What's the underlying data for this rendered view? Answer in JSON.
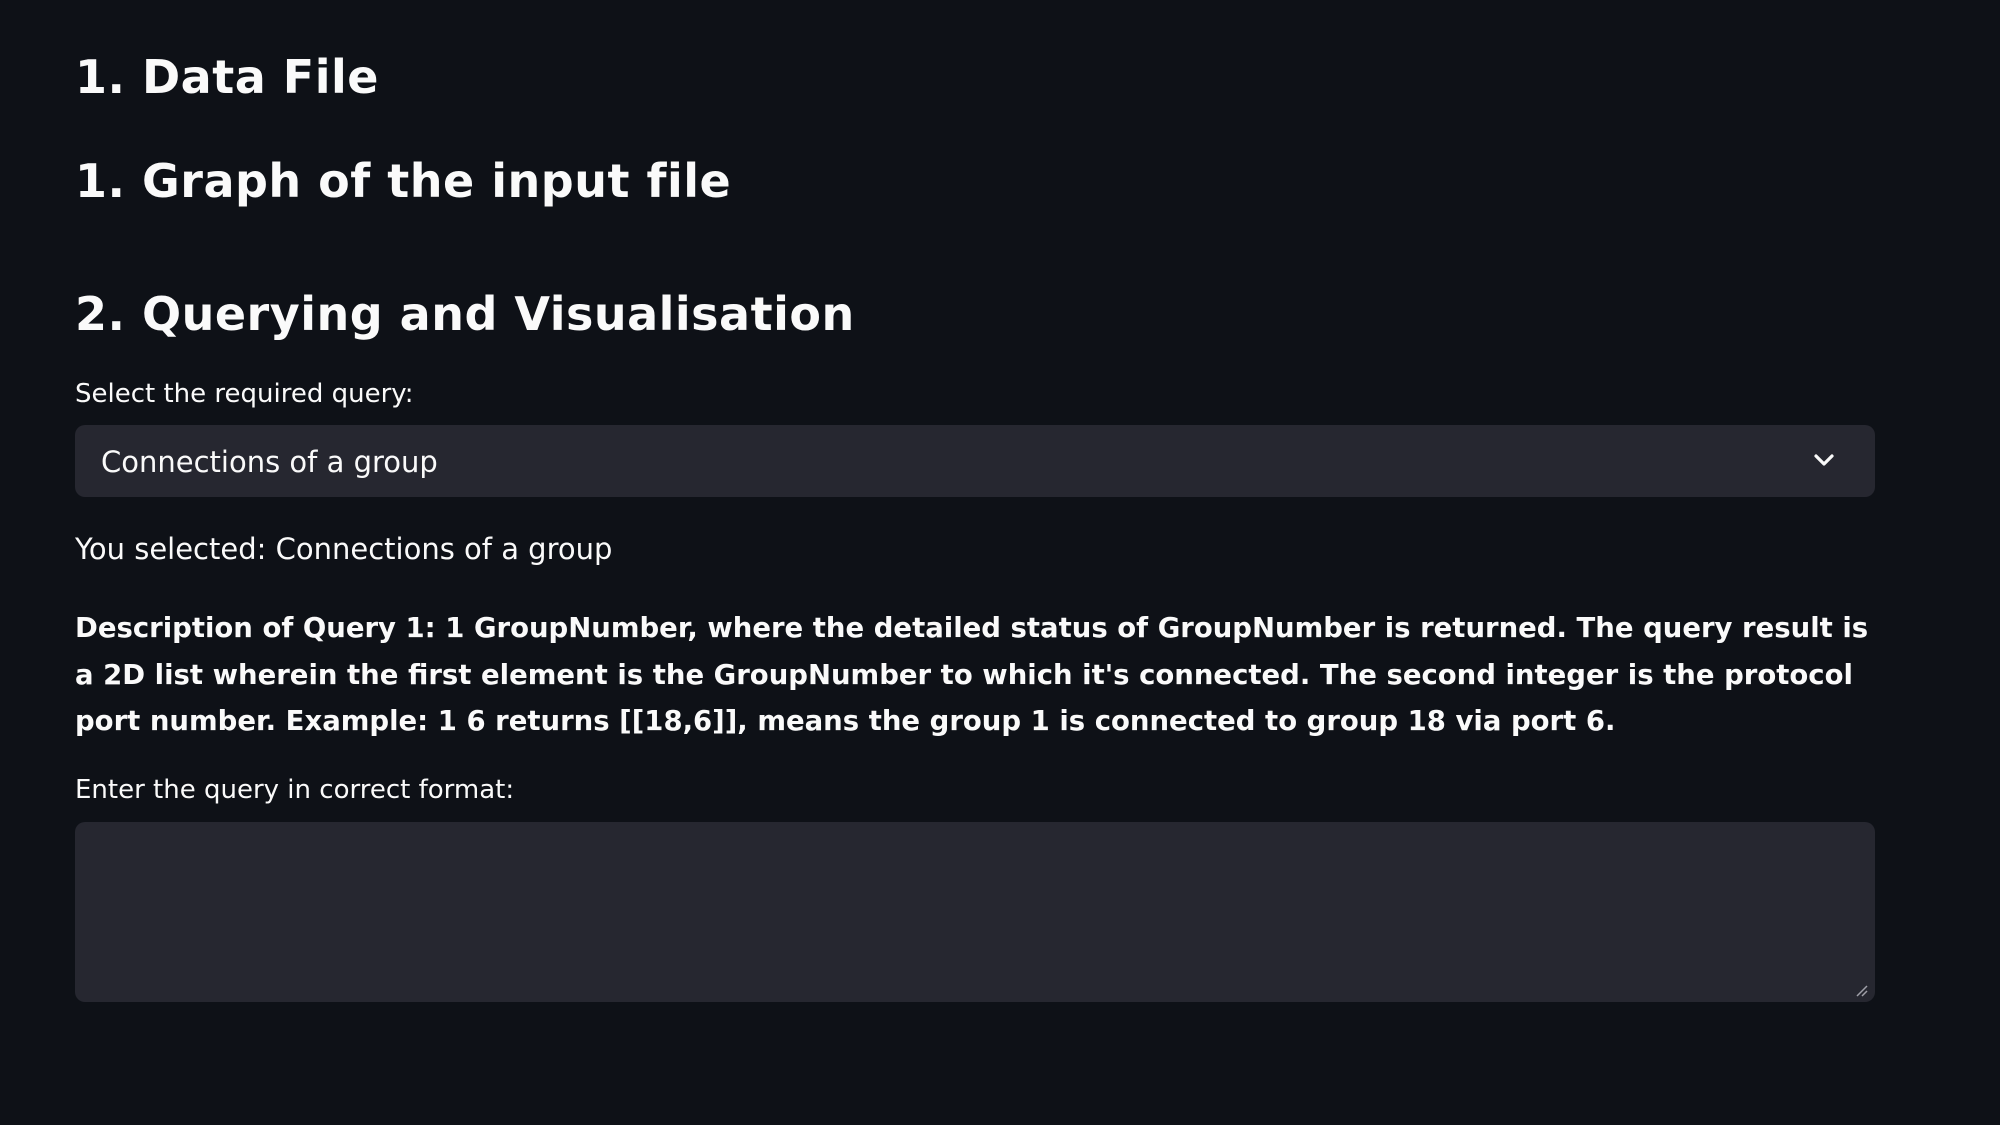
{
  "headings": {
    "data_file": "1. Data File",
    "graph": "1. Graph of the input file",
    "querying": "2. Querying and Visualisation"
  },
  "query_select": {
    "label": "Select the required query:",
    "selected_value": "Connections of a group",
    "icon": "chevron-down-icon"
  },
  "selection_status": "You selected: Connections of a group",
  "description": "Description of Query 1: 1 GroupNumber, where the detailed status of GroupNumber is returned. The query result is a 2D list wherein the first element is the GroupNumber to which it's connected. The second integer is the protocol port number. Example: 1 6 returns [[18,6]], means the group 1 is connected to group 18 via port 6.",
  "query_input": {
    "label": "Enter the query in correct format:",
    "value": "",
    "placeholder": ""
  },
  "colors": {
    "background": "#0e1117",
    "input_background": "#262730",
    "text": "#fafafa"
  }
}
